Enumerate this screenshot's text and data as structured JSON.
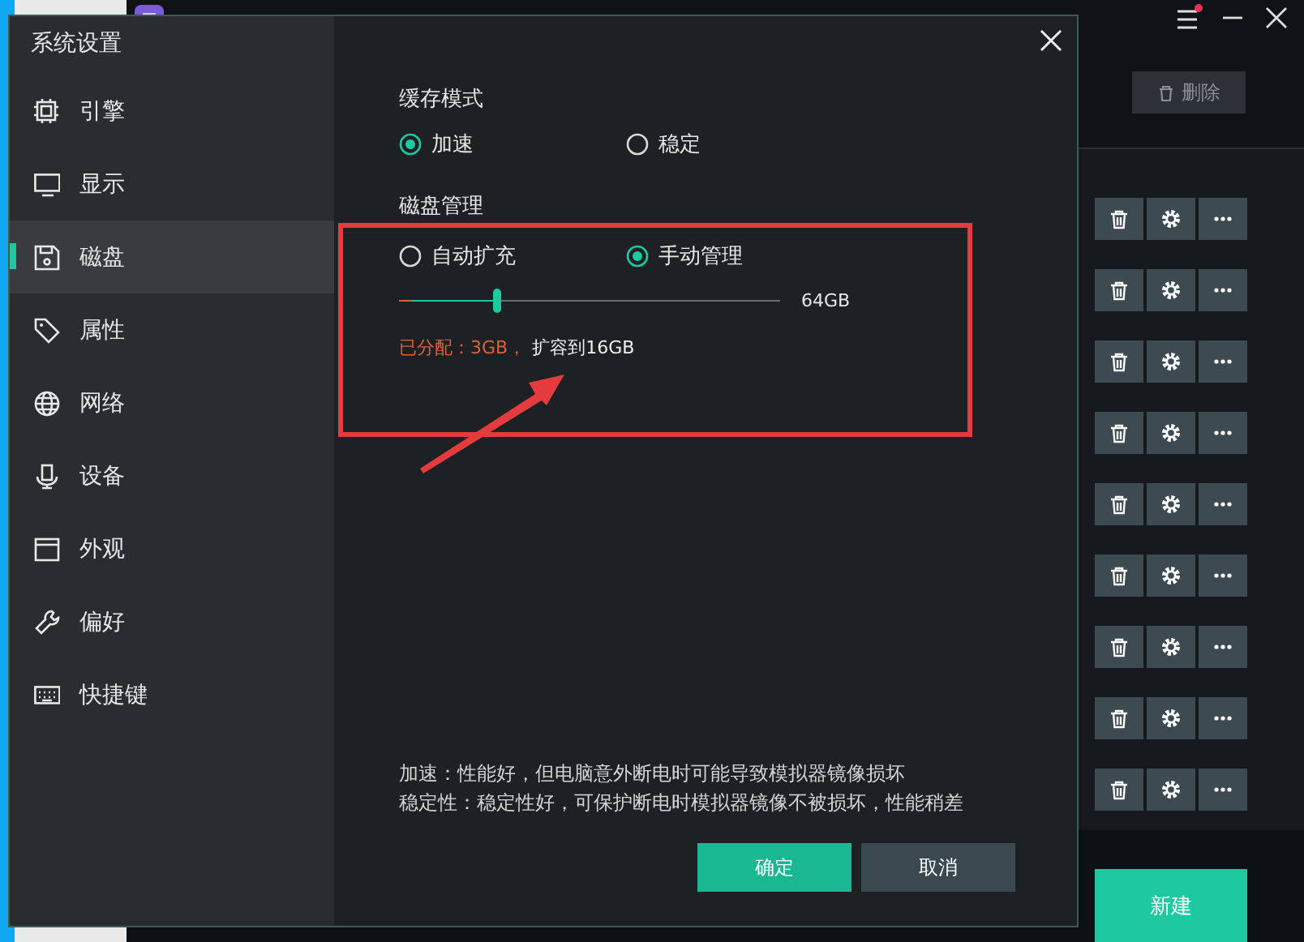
{
  "app": {
    "delete_button": "删除",
    "rows": [
      {
        "kind": "instance"
      },
      {
        "kind": "instance"
      },
      {
        "kind": "instance"
      },
      {
        "kind": "instance"
      },
      {
        "kind": "instance"
      },
      {
        "kind": "instance"
      },
      {
        "kind": "instance"
      },
      {
        "kind": "instance"
      },
      {
        "kind": "instance"
      }
    ],
    "new_button": "新建"
  },
  "dialog": {
    "title": "系统设置",
    "sidebar": {
      "items": [
        {
          "label": "引擎",
          "selected": false
        },
        {
          "label": "显示",
          "selected": false
        },
        {
          "label": "磁盘",
          "selected": true
        },
        {
          "label": "属性",
          "selected": false
        },
        {
          "label": "网络",
          "selected": false
        },
        {
          "label": "设备",
          "selected": false
        },
        {
          "label": "外观",
          "selected": false
        },
        {
          "label": "偏好",
          "selected": false
        },
        {
          "label": "快捷键",
          "selected": false
        }
      ]
    },
    "cache_mode": {
      "title": "缓存模式",
      "options": [
        {
          "label": "加速",
          "selected": true
        },
        {
          "label": "稳定",
          "selected": false
        }
      ]
    },
    "disk": {
      "title": "磁盘管理",
      "options": [
        {
          "label": "自动扩充",
          "selected": false
        },
        {
          "label": "手动管理",
          "selected": true
        }
      ],
      "slider": {
        "level": 0.255
      },
      "max_label": "64GB",
      "allocated": "已分配：3GB，",
      "expand": "扩容到16GB"
    },
    "notes": [
      "加速：性能好，但电脑意外断电时可能导致模拟器镜像损坏",
      "稳定性：稳定性好，可保护断电时模拟器镜像不被损坏，性能稍差"
    ],
    "buttons": [
      {
        "label": "确定",
        "kind": "primary"
      },
      {
        "label": "取消",
        "kind": "secondary"
      }
    ]
  },
  "annotations": [
    {
      "kind": "box"
    },
    {
      "kind": "arrow"
    }
  ]
}
